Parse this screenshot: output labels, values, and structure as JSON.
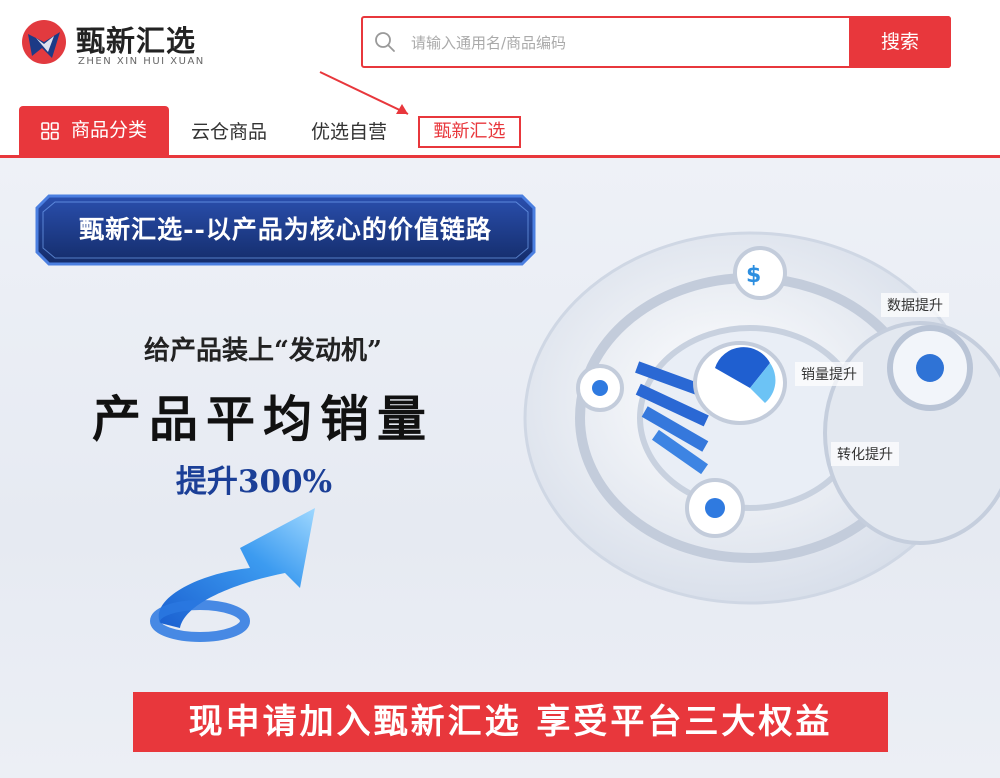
{
  "header": {
    "logo": {
      "name_cn": "甄新汇选",
      "name_en": "ZHEN XIN HUI XUAN"
    },
    "search": {
      "placeholder": "请输入通用名/商品编码",
      "value": "",
      "button_label": "搜索"
    }
  },
  "nav": {
    "tabs": [
      {
        "label": "商品分类",
        "icon": "grid-icon",
        "active": true
      },
      {
        "label": "云仓商品"
      },
      {
        "label": "优选自营"
      },
      {
        "label": "甄新汇选",
        "highlighted": true
      }
    ]
  },
  "banner": {
    "title": "甄新汇选--以产品为核心的价值链路",
    "subtitle": "给产品装上“发动机”",
    "headline": "产品平均销量",
    "boost": "提升300%",
    "callouts": [
      "数据提升",
      "销量提升",
      "转化提升"
    ],
    "cta": "现申请加入甄新汇选  享受平台三大权益"
  },
  "colors": {
    "accent": "#e8373c",
    "title_blue": "#1b3f97",
    "plate_dark": "#17306f"
  }
}
